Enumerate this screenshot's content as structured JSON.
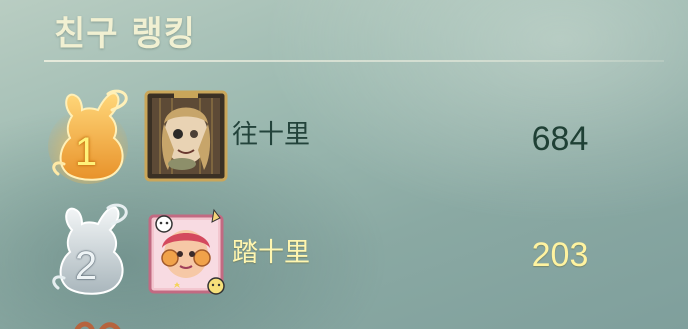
{
  "header": {
    "title": "친구 랭킹"
  },
  "ranking": [
    {
      "rank": "1",
      "name": "往十里",
      "score": "684",
      "avatar_icon": "survivor-doll-portrait-icon",
      "badge_icon": "gold-rabbit-icon"
    },
    {
      "rank": "2",
      "name": "踏十里",
      "score": "203",
      "avatar_icon": "pink-sticker-portrait-icon",
      "badge_icon": "silver-rabbit-icon"
    }
  ],
  "colors": {
    "title": "#f1f0d2",
    "first_place_name": "#23433b",
    "highlight_name": "#fff6b0",
    "gold": "#f3b23a",
    "silver": "#c9d2d6"
  }
}
